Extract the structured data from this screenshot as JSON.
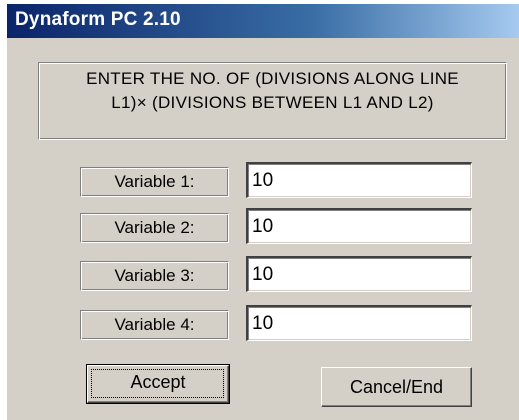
{
  "window": {
    "title": "Dynaform PC 2.10"
  },
  "message": {
    "line1": "ENTER THE NO. OF (DIVISIONS ALONG LINE",
    "line2": "L1)× (DIVISIONS BETWEEN L1 AND L2)"
  },
  "variables": [
    {
      "label": "Variable 1:",
      "value": "10"
    },
    {
      "label": "Variable 2:",
      "value": "10"
    },
    {
      "label": "Variable 3:",
      "value": "10"
    },
    {
      "label": "Variable 4:",
      "value": "10"
    }
  ],
  "buttons": {
    "accept": "Accept",
    "cancel": "Cancel/End"
  },
  "colors": {
    "dialog_face": "#d4d0c8",
    "titlebar_start": "#0a246a",
    "titlebar_end": "#a6caf0",
    "title_text": "#ffffff"
  }
}
